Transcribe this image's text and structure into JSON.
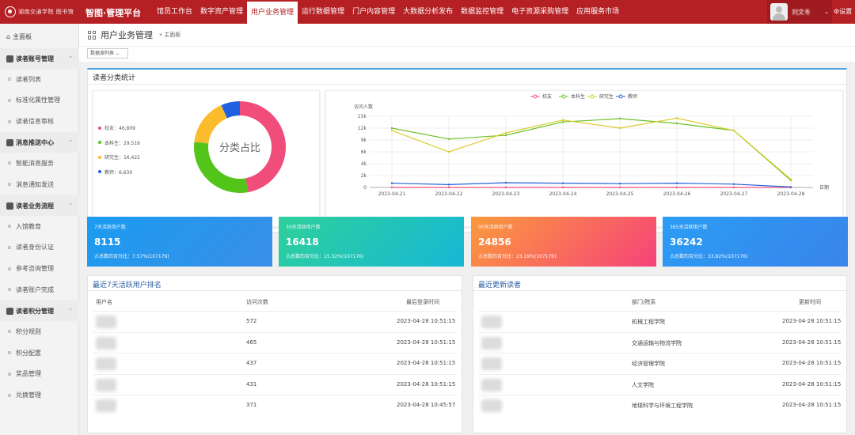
{
  "topbar": {
    "logo_text": "湖南交通学院 图书馆",
    "app_title": "智图·管理平台",
    "nav": [
      "馆员工作台",
      "数字资产管理",
      "用户业务管理",
      "运行数据管理",
      "门户内容管理",
      "大数据分析发布",
      "数据监控管理",
      "电子资源采购管理",
      "应用服务市场"
    ],
    "active_nav": "用户业务管理",
    "user_name": "刘文冬",
    "settings_label": "⚙设置"
  },
  "sidebar": {
    "home": "主面板",
    "groups": [
      {
        "label": "读者账号管理",
        "items": [
          "读者列表",
          "标准化属性管理",
          "读者信息审核"
        ]
      },
      {
        "label": "消息推送中心",
        "items": [
          "智能消息服务",
          "消息通知发送"
        ]
      },
      {
        "label": "读者业务流程",
        "items": [
          "入馆教育",
          "读者身份认证",
          "参考咨询管理",
          "读者账户完成"
        ]
      },
      {
        "label": "读者积分管理",
        "items": [
          "积分规则",
          "积分配置",
          "奖品管理",
          "兑换管理"
        ]
      }
    ]
  },
  "breadcrumb": {
    "title": "用户业务管理",
    "sep": "»",
    "home": "主面板"
  },
  "filter": {
    "selected": "数据源列表 ⌄"
  },
  "category_panel": {
    "title": "读者分类统计",
    "donut_center": "分类占比",
    "legend": [
      {
        "label": "校友：46,809",
        "color": "#f04d7a"
      },
      {
        "label": "本科生：29,516",
        "color": "#52c41a"
      },
      {
        "label": "研究生：16,422",
        "color": "#fbbc2c"
      },
      {
        "label": "教师：6,630",
        "color": "#1f5fe0"
      }
    ]
  },
  "chart_data": {
    "type": "line",
    "ylabel": "访问人数",
    "xlabel": "日期",
    "x": [
      "2023-04-21",
      "2023-04-22",
      "2023-04-23",
      "2023-04-24",
      "2023-04-25",
      "2023-04-26",
      "2023-04-27",
      "2023-04-28"
    ],
    "yticks": [
      "0",
      "2k",
      "4k",
      "6k",
      "9k",
      "12k",
      "15k"
    ],
    "ylim": [
      0,
      15000
    ],
    "grid": true,
    "legend_position": "top",
    "series": [
      {
        "name": "校友",
        "color": "#f04d7a",
        "values": [
          0,
          0,
          0,
          0,
          0,
          0,
          0,
          0
        ]
      },
      {
        "name": "本科生",
        "color": "#6cc025",
        "values": [
          12500,
          10200,
          11000,
          13800,
          14500,
          13500,
          12000,
          1500
        ]
      },
      {
        "name": "研究生",
        "color": "#dccb2a",
        "values": [
          12000,
          7500,
          11500,
          14200,
          12500,
          14600,
          12000,
          1700
        ]
      },
      {
        "name": "教师",
        "color": "#2560d8",
        "values": [
          900,
          600,
          1000,
          900,
          800,
          900,
          700,
          100
        ]
      }
    ]
  },
  "stats": [
    {
      "title": "7天活跃用户数",
      "value": "8115",
      "sub": "占总数的百分比：7.57%(107176)",
      "from": "#1a9cf0",
      "to": "#3a8fe8"
    },
    {
      "title": "30天活跃用户数",
      "value": "16418",
      "sub": "占总数的百分比：15.32%(107176)",
      "from": "#2fd09a",
      "to": "#16b8d6"
    },
    {
      "title": "90天活跃用户数",
      "value": "24856",
      "sub": "占总数的百分比：23.19%(107176)",
      "from": "#fb9a3c",
      "to": "#f6437a"
    },
    {
      "title": "365天活跃用户数",
      "value": "36242",
      "sub": "占总数的百分比：33.82%(107176)",
      "from": "#2a9df5",
      "to": "#3a84ea"
    }
  ],
  "active_users": {
    "title": "最近7天活跃用户排名",
    "headers": [
      "用户名",
      "访问次数",
      "最后登录时间"
    ],
    "rows": [
      {
        "visits": "572",
        "last": "2023-04-28 10:51:15"
      },
      {
        "visits": "465",
        "last": "2023-04-28 10:51:15"
      },
      {
        "visits": "437",
        "last": "2023-04-28 10:51:15"
      },
      {
        "visits": "431",
        "last": "2023-04-28 10:51:15"
      },
      {
        "visits": "371",
        "last": "2023-04-28 10:45:57"
      }
    ]
  },
  "recent_readers": {
    "title": "最近更新读者",
    "headers": [
      "部门/院系",
      "更新时间"
    ],
    "rows": [
      {
        "dept": "机械工程学院",
        "time": "2023-04-28 10:51:15"
      },
      {
        "dept": "交通运输与物流学院",
        "time": "2023-04-28 10:51:15"
      },
      {
        "dept": "经济管理学院",
        "time": "2023-04-28 10:51:15"
      },
      {
        "dept": "人文学院",
        "time": "2023-04-28 10:51:15"
      },
      {
        "dept": "地球科学与环境工程学院",
        "time": "2023-04-28 10:51:15"
      }
    ]
  }
}
